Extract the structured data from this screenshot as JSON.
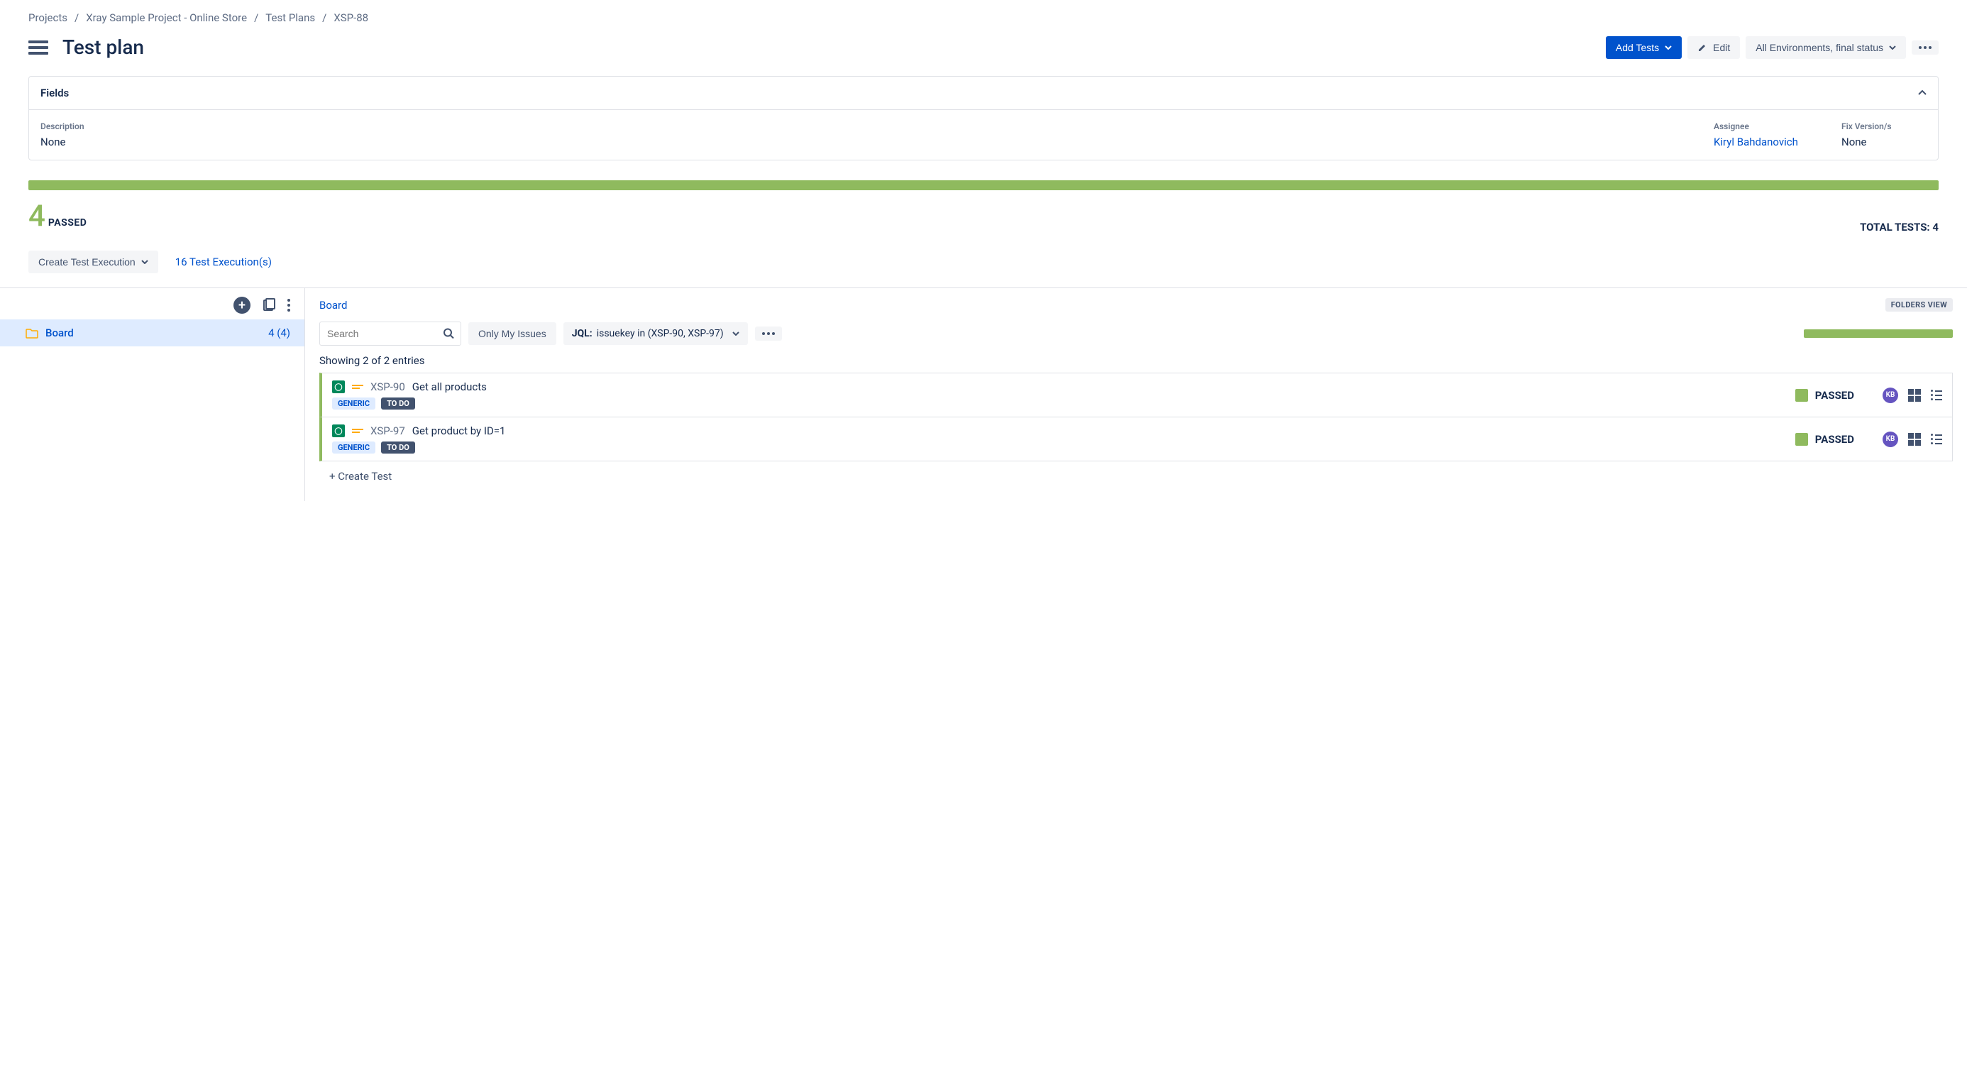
{
  "breadcrumb": [
    "Projects",
    "Xray Sample Project - Online Store",
    "Test Plans",
    "XSP-88"
  ],
  "page_title": "Test plan",
  "actions": {
    "add_tests": "Add Tests",
    "edit": "Edit",
    "environments": "All Environments, final status"
  },
  "fields": {
    "header": "Fields",
    "description": {
      "label": "Description",
      "value": "None"
    },
    "assignee": {
      "label": "Assignee",
      "value": "Kiryl Bahdanovich"
    },
    "fix_version": {
      "label": "Fix Version/s",
      "value": "None"
    }
  },
  "stats": {
    "count": "4",
    "label": "PASSED",
    "total": "TOTAL TESTS: 4"
  },
  "exec": {
    "create": "Create Test Execution",
    "link": "16 Test Execution(s)"
  },
  "folder": {
    "name": "Board",
    "counts": "4 (4)"
  },
  "board": {
    "title": "Board",
    "folders_view": "FOLDERS VIEW",
    "search_placeholder": "Search",
    "only_my_issues": "Only My Issues",
    "jql_label": "JQL:",
    "jql_query": "issuekey in (XSP-90, XSP-97)",
    "entries": "Showing 2 of 2 entries",
    "create_test": "+ Create Test"
  },
  "tests": [
    {
      "key": "XSP-90",
      "name": "Get all products",
      "type": "GENERIC",
      "workflow": "TO DO",
      "status": "PASSED",
      "avatar": "KB"
    },
    {
      "key": "XSP-97",
      "name": "Get product by ID=1",
      "type": "GENERIC",
      "workflow": "TO DO",
      "status": "PASSED",
      "avatar": "KB"
    }
  ]
}
